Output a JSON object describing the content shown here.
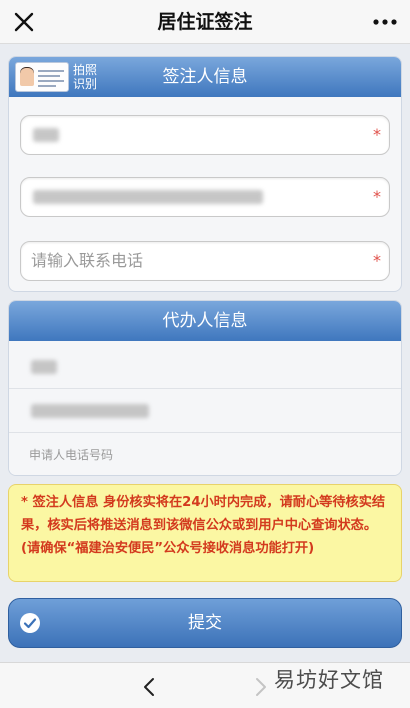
{
  "topbar": {
    "title": "居住证签注"
  },
  "signer_section": {
    "title": "签注人信息",
    "scan_label": "拍照识别",
    "phone_placeholder": "请输入联系电话",
    "required_mark": "*"
  },
  "agent_section": {
    "title": "代办人信息",
    "phone_hint": "申请人电话号码"
  },
  "notice": {
    "text": "* 签注人信息 身份核实将在24小时内完成，请耐心等待核实结果，核实后将推送消息到该微信公众或到用户中心查询状态。(请确保“福建治安便民”公众号接收消息功能打开)"
  },
  "submit": {
    "label": "提交"
  },
  "watermark": {
    "text": "易坊好文馆"
  },
  "icons": {
    "close": "close-icon",
    "more": "more-icon",
    "id_card": "id-card-icon",
    "check": "check-circle-icon",
    "back": "chevron-left-icon",
    "forward": "chevron-right-icon"
  },
  "colors": {
    "header_blue": "#3f77be",
    "required_red": "#e0504a",
    "notice_bg": "#fbf7a3",
    "notice_text": "#d33a1e"
  }
}
